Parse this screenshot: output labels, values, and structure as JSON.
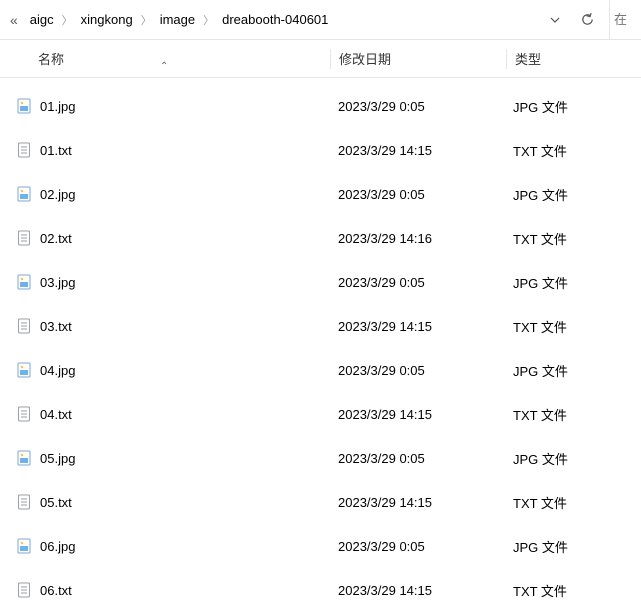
{
  "breadcrumb": {
    "back": "«",
    "items": [
      "aigc",
      "xingkong",
      "image",
      "dreabooth-040601"
    ]
  },
  "search": {
    "placeholder": "在"
  },
  "columns": {
    "name": "名称",
    "date": "修改日期",
    "type": "类型",
    "sort_indicator": "⌃"
  },
  "type_labels": {
    "jpg": "JPG 文件",
    "txt": "TXT 文件"
  },
  "files": [
    {
      "name": "01.jpg",
      "date": "2023/3/29 0:05",
      "kind": "jpg"
    },
    {
      "name": "01.txt",
      "date": "2023/3/29 14:15",
      "kind": "txt"
    },
    {
      "name": "02.jpg",
      "date": "2023/3/29 0:05",
      "kind": "jpg"
    },
    {
      "name": "02.txt",
      "date": "2023/3/29 14:16",
      "kind": "txt"
    },
    {
      "name": "03.jpg",
      "date": "2023/3/29 0:05",
      "kind": "jpg"
    },
    {
      "name": "03.txt",
      "date": "2023/3/29 14:15",
      "kind": "txt"
    },
    {
      "name": "04.jpg",
      "date": "2023/3/29 0:05",
      "kind": "jpg"
    },
    {
      "name": "04.txt",
      "date": "2023/3/29 14:15",
      "kind": "txt"
    },
    {
      "name": "05.jpg",
      "date": "2023/3/29 0:05",
      "kind": "jpg"
    },
    {
      "name": "05.txt",
      "date": "2023/3/29 14:15",
      "kind": "txt"
    },
    {
      "name": "06.jpg",
      "date": "2023/3/29 0:05",
      "kind": "jpg"
    },
    {
      "name": "06.txt",
      "date": "2023/3/29 14:15",
      "kind": "txt"
    }
  ]
}
